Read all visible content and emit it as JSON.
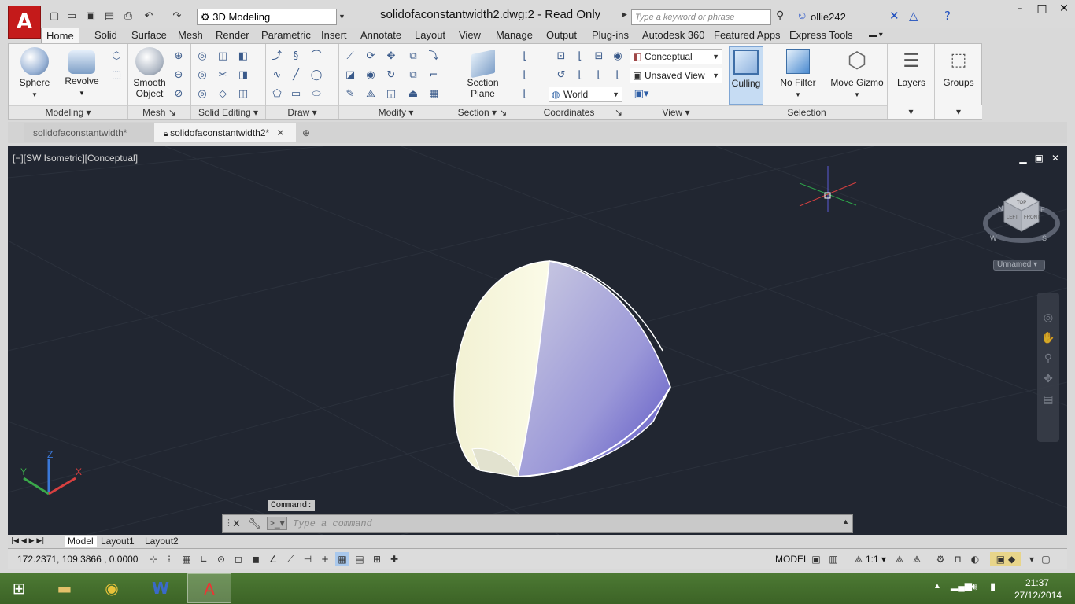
{
  "titlebar": {
    "workspace": "3D Modeling",
    "document_title": "solidofaconstantwidth2.dwg:2 - Read Only",
    "search_placeholder": "Type a keyword or phrase",
    "username": "ollie242"
  },
  "ribbon_tabs": [
    "Home",
    "Solid",
    "Surface",
    "Mesh",
    "Render",
    "Parametric",
    "Insert",
    "Annotate",
    "Layout",
    "View",
    "Manage",
    "Output",
    "Plug-ins",
    "Autodesk 360",
    "Featured Apps",
    "Express Tools"
  ],
  "panels": {
    "modeling": {
      "title": "Modeling",
      "sphere": "Sphere",
      "revolve": "Revolve"
    },
    "mesh": {
      "title": "Mesh",
      "smooth_object_line1": "Smooth",
      "smooth_object_line2": "Object"
    },
    "solid_editing": {
      "title": "Solid Editing"
    },
    "draw": {
      "title": "Draw"
    },
    "modify": {
      "title": "Modify"
    },
    "section": {
      "title": "Section",
      "section_plane_line1": "Section",
      "section_plane_line2": "Plane"
    },
    "coordinates": {
      "title": "Coordinates",
      "ucs_world": "World"
    },
    "view": {
      "title": "View",
      "visual_style": "Conceptual",
      "named_view": "Unsaved View"
    },
    "selection": {
      "title": "Selection",
      "culling": "Culling",
      "no_filter": "No Filter",
      "move_gizmo": "Move Gizmo"
    },
    "layers": {
      "label": "Layers"
    },
    "groups": {
      "label": "Groups"
    }
  },
  "doc_tabs": [
    "solidofaconstantwidth*",
    "solidofaconstantwidth2*"
  ],
  "viewport": {
    "label": "[−][SW Isometric][Conceptual]",
    "viewcube_named": "Unnamed",
    "viewcube_faces": {
      "top": "TOP",
      "left": "LEFT",
      "front": "FRONT"
    },
    "compass": {
      "n": "N",
      "e": "E",
      "s": "S",
      "w": "W"
    },
    "axes": {
      "x": "X",
      "y": "Y",
      "z": "Z"
    }
  },
  "command": {
    "prompt": "Command:",
    "placeholder": "Type a command"
  },
  "layout_tabs": [
    "Model",
    "Layout1",
    "Layout2"
  ],
  "statusbar": {
    "coordinates": "172.2371, 109.3866 , 0.0000",
    "model": "MODEL",
    "annotation_scale": "1:1"
  },
  "taskbar": {
    "time": "21:37",
    "date": "27/12/2014"
  },
  "colors": {
    "viewport_bg": "#212631",
    "acad_red": "#c41a1a",
    "taskbar_green": "#4d7a34",
    "solid_light": "#f7f6dc",
    "solid_blue": "#6f69c9"
  }
}
